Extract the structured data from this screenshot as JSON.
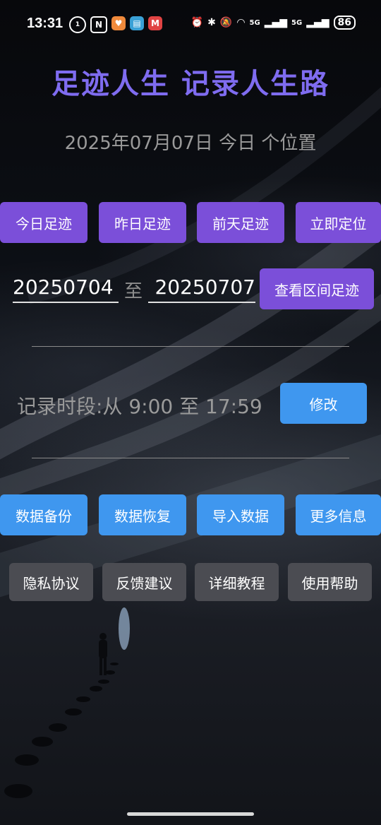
{
  "status_bar": {
    "time": "13:31",
    "battery": "86",
    "net1": "5G",
    "net2": "5G"
  },
  "header": {
    "title": "足迹人生  记录人生路",
    "date_text": "2025年07月07日   今日  个位置"
  },
  "quick_buttons": {
    "today": "今日足迹",
    "yesterday": "昨日足迹",
    "day_before": "前天足迹",
    "locate_now": "立即定位"
  },
  "range": {
    "start_date": "20250704",
    "to_label": "至",
    "end_date": "20250707",
    "query_button": "查看区间足迹"
  },
  "record": {
    "text": "记录时段:从 9:00 至 17:59",
    "edit_button": "修改"
  },
  "data_buttons": {
    "backup": "数据备份",
    "restore": "数据恢复",
    "import": "导入数据",
    "more": "更多信息"
  },
  "info_buttons": {
    "privacy": "隐私协议",
    "feedback": "反馈建议",
    "tutorial": "详细教程",
    "help": "使用帮助"
  },
  "colors": {
    "title": "#7f6cf0",
    "purple_button": "#7b4fd9",
    "blue_button": "#3f97ef",
    "gray_button": "#4b4c52"
  }
}
